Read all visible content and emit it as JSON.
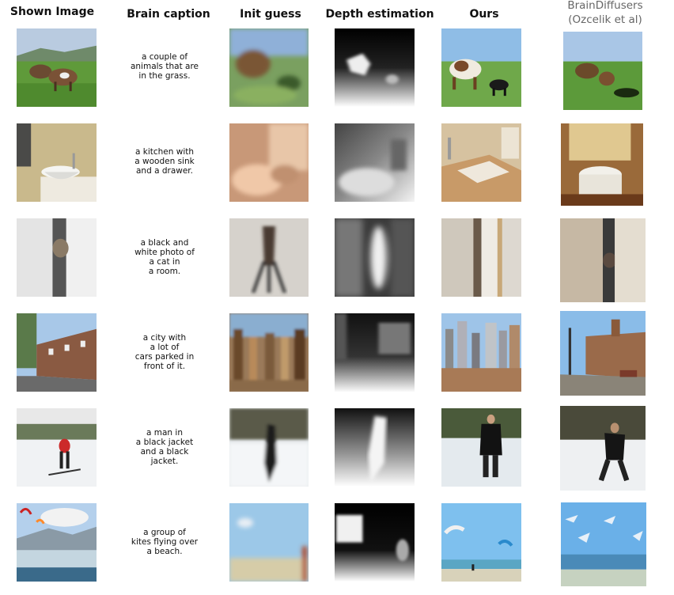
{
  "headers": {
    "shown": "Shown Image",
    "caption": "Brain caption",
    "init": "Init guess",
    "depth": "Depth estimation",
    "ours": "Ours",
    "braindiff_line1": "BrainDiffusers",
    "braindiff_line2": "(Ozcelik et al)"
  },
  "rows": [
    {
      "caption_lines": [
        "a couple of",
        "animals that are",
        "in the grass."
      ]
    },
    {
      "caption_lines": [
        "a kitchen with",
        "a wooden sink",
        "and a drawer."
      ]
    },
    {
      "caption_lines": [
        "a black and",
        "white photo of",
        "a cat in",
        "a room."
      ]
    },
    {
      "caption_lines": [
        "a city with",
        "a lot of",
        "cars parked in",
        "front of it."
      ]
    },
    {
      "caption_lines": [
        "a man in",
        "a black jacket",
        "and a black",
        "jacket."
      ]
    },
    {
      "caption_lines": [
        "a group of",
        "kites flying over",
        "a beach."
      ]
    }
  ]
}
